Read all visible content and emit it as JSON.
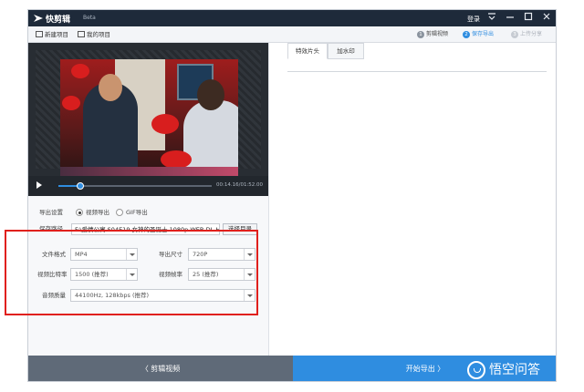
{
  "titlebar": {
    "app_name": "快剪辑",
    "badge": "Beta",
    "login": "登录",
    "icons": [
      "menu-icon",
      "minimize-icon",
      "maximize-icon",
      "close-icon"
    ]
  },
  "toolbar": {
    "new_project": "新建项目",
    "my_projects": "我的项目",
    "steps": [
      {
        "num": "1",
        "label": "剪辑视频",
        "state": "done"
      },
      {
        "num": "2",
        "label": "保存导出",
        "state": "active"
      },
      {
        "num": "3",
        "label": "上传分享",
        "state": "pending"
      }
    ]
  },
  "player": {
    "time": "00:14.16/01:52.00",
    "progress": 0.14
  },
  "export": {
    "export_settings_label": "导出设置",
    "option_video": "视频导出",
    "option_gif": "GIF导出",
    "selected": "视频导出",
    "save_path_label": "保存路径",
    "save_path_value": "F:\\爱情公寓.S04E19.女神的圣诞士.1080p.WEB-DL.H.",
    "browse_button": "选择目录",
    "file_format_label": "文件格式",
    "file_format_value": "MP4",
    "export_size_label": "导出尺寸",
    "export_size_value": "720P",
    "video_bitrate_label": "视频比特率",
    "video_bitrate_value": "1500 (推荐)",
    "frame_rate_label": "视频帧率",
    "frame_rate_value": "25 (推荐)",
    "audio_quality_label": "音频质量",
    "audio_quality_value": "44100Hz, 128kbps (推荐)"
  },
  "right_panel": {
    "tabs": [
      "特效片头",
      "加水印"
    ],
    "active_tab": "特效片头"
  },
  "bottom": {
    "back_label": "剪辑视频",
    "start_label": "开始导出"
  },
  "watermark": {
    "text": "悟空问答"
  },
  "colors": {
    "accent": "#2f8de0",
    "titlebar": "#1e2a3a",
    "highlight": "#e0201c"
  }
}
